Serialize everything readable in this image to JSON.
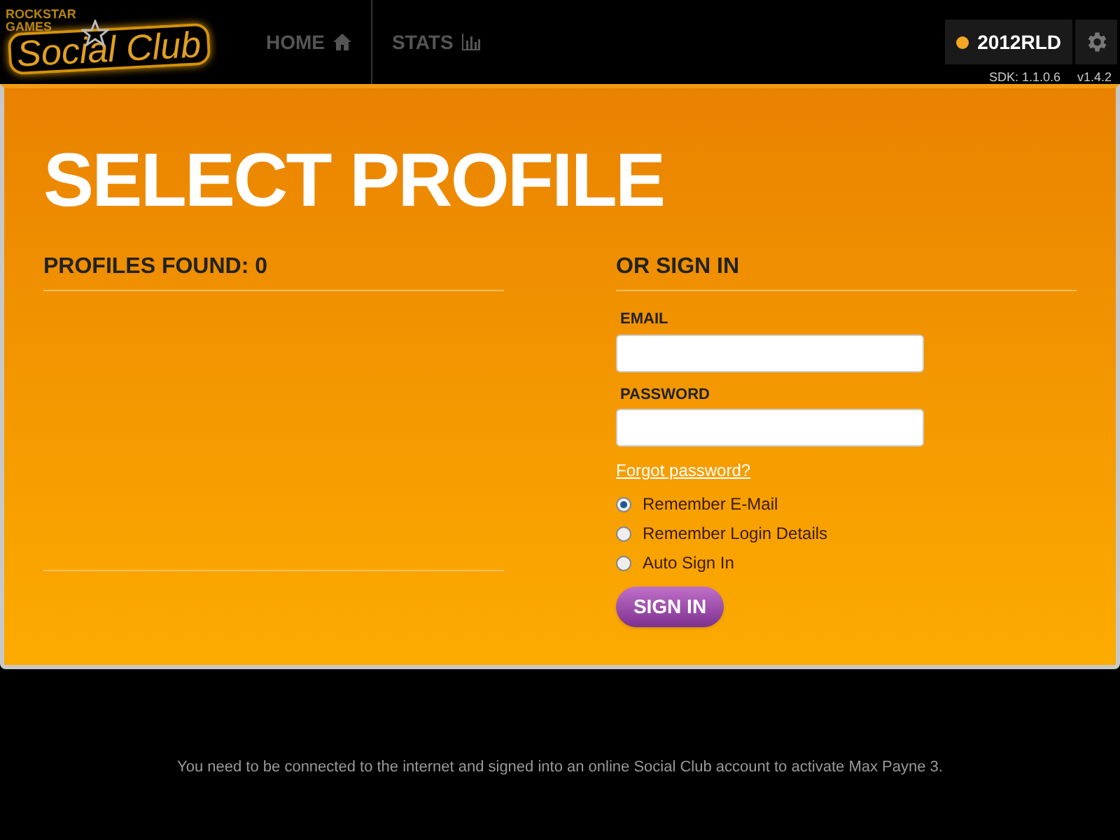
{
  "logo": {
    "publisher": "ROCKSTAR GAMES",
    "title": "Social Club"
  },
  "nav": [
    {
      "label": "HOME",
      "selected": false
    },
    {
      "label": "STATS",
      "selected": false
    }
  ],
  "user": {
    "name": "2012RLD"
  },
  "sdk": "SDK: 1.1.0.6",
  "version": "v1.4.2",
  "page": {
    "title": "SELECT PROFILE",
    "profiles_heading": "PROFILES FOUND: 0",
    "signin_heading": "OR SIGN IN"
  },
  "fields": [
    {
      "label": "EMAIL"
    },
    {
      "label": "PASSWORD"
    }
  ],
  "forgot_link": "Forgot password?",
  "options": [
    {
      "label": "Remember E-Mail",
      "selected": true
    },
    {
      "label": "Remember Login Details",
      "selected": false
    },
    {
      "label": "Auto Sign In",
      "selected": false
    }
  ],
  "sign_in_button": "SIGN IN",
  "footer": "You need to be connected to the internet and signed into an online Social Club account to activate Max Payne 3."
}
